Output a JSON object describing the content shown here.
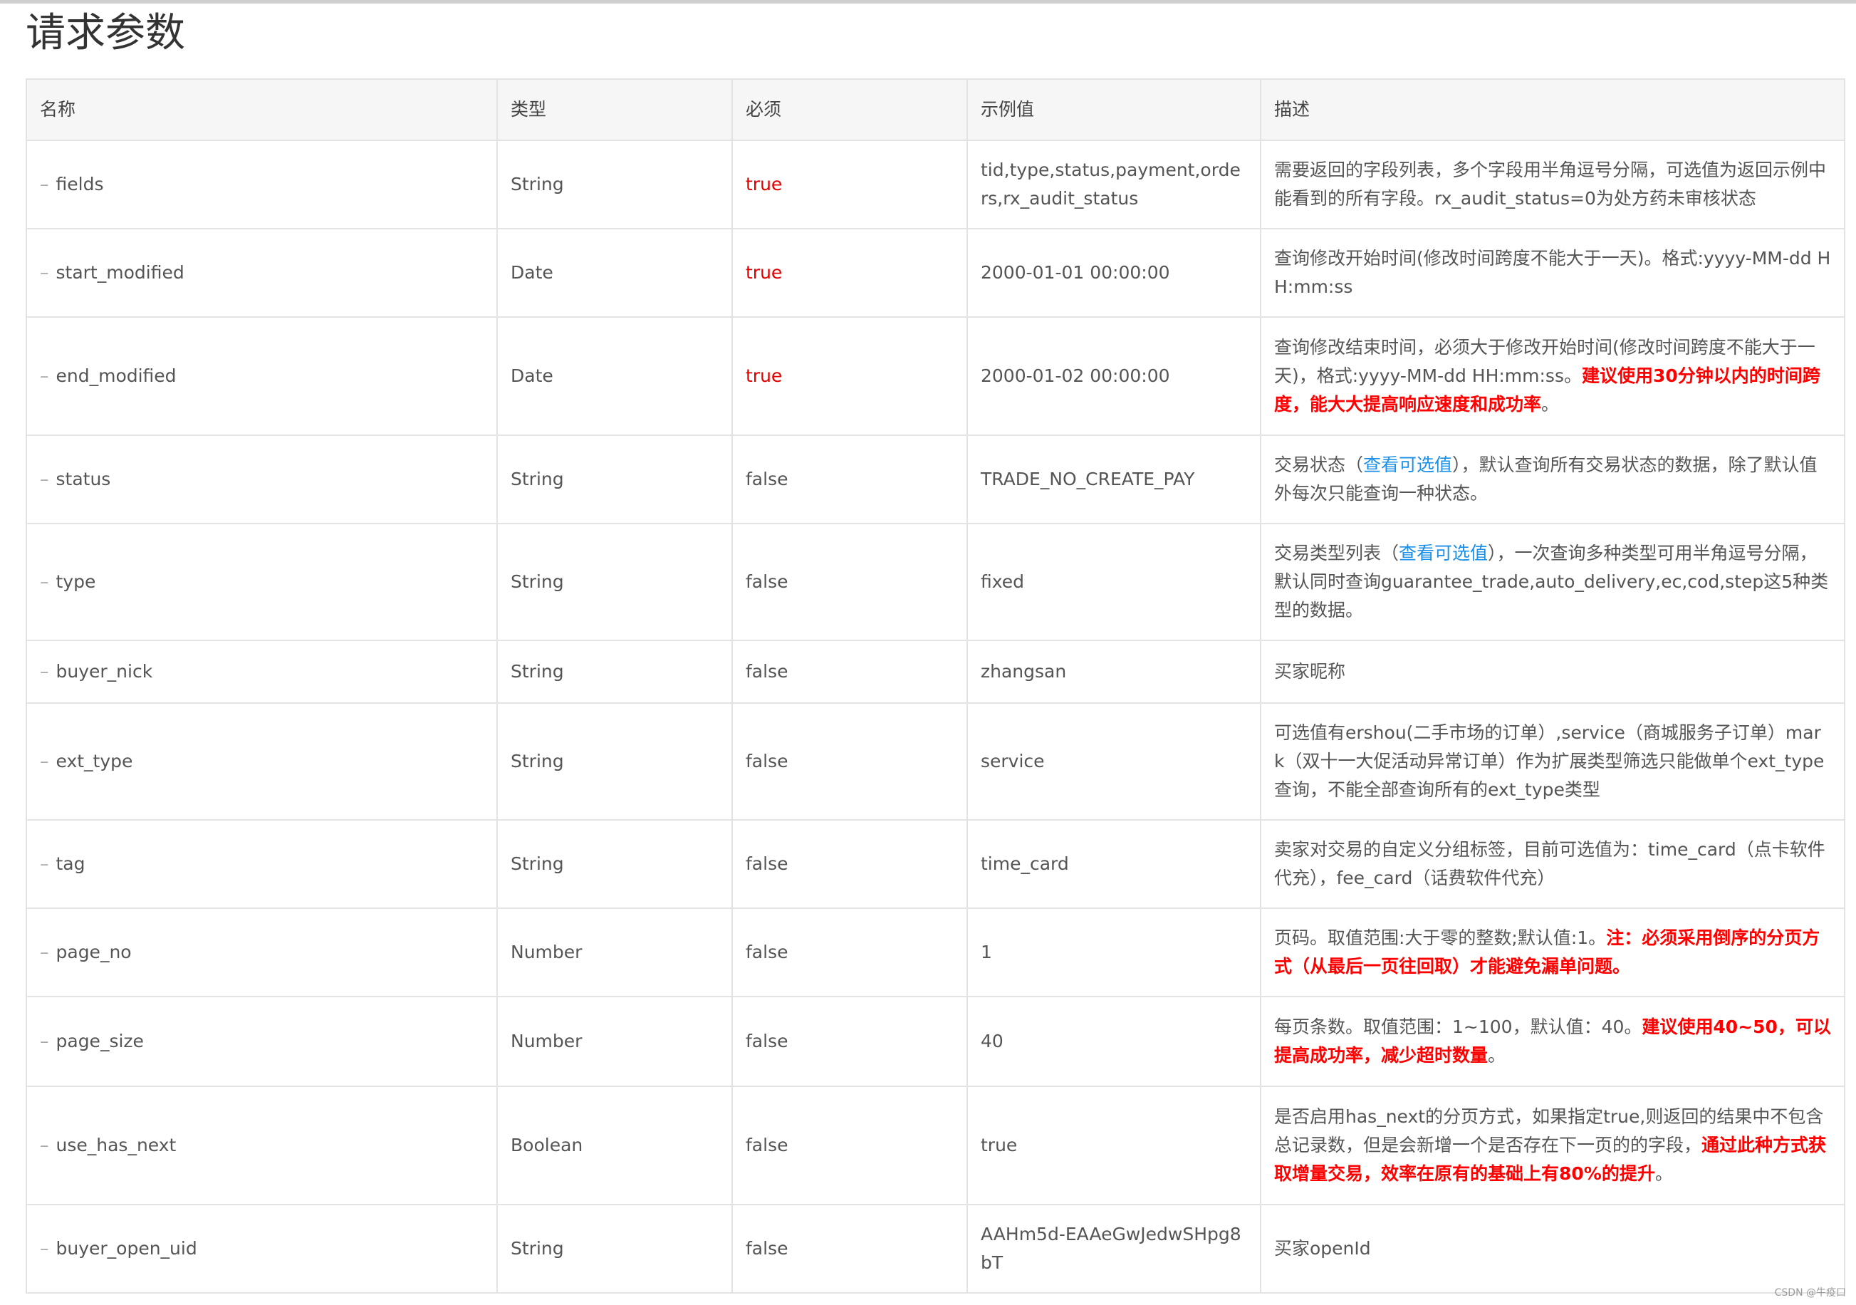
{
  "page_title": "请求参数",
  "table": {
    "headers": [
      "名称",
      "类型",
      "必须",
      "示例值",
      "描述"
    ],
    "rows": [
      {
        "name": "fields",
        "type": "String",
        "required": "true",
        "example": "tid,type,status,payment,orders,rx_audit_status",
        "desc": [
          {
            "t": "需要返回的字段列表，多个字段用半角逗号分隔，可选值为返回示例中能看到的所有字段。rx_audit_status=0为处方药未审核状态",
            "s": ""
          }
        ]
      },
      {
        "name": "start_modified",
        "type": "Date",
        "required": "true",
        "example": "2000-01-01 00:00:00",
        "desc": [
          {
            "t": "查询修改开始时间(修改时间跨度不能大于一天)。格式:yyyy-MM-dd HH:mm:ss",
            "s": ""
          }
        ]
      },
      {
        "name": "end_modified",
        "type": "Date",
        "required": "true",
        "example": "2000-01-02 00:00:00",
        "desc": [
          {
            "t": "查询修改结束时间，必须大于修改开始时间(修改时间跨度不能大于一天)，格式:yyyy-MM-dd HH:mm:ss。",
            "s": ""
          },
          {
            "t": "建议使用30分钟以内的时间跨度，能大大提高响应速度和成功率",
            "s": "strong"
          },
          {
            "t": "。",
            "s": ""
          }
        ]
      },
      {
        "name": "status",
        "type": "String",
        "required": "false",
        "example": "TRADE_NO_CREATE_PAY",
        "desc": [
          {
            "t": "交易状态（",
            "s": ""
          },
          {
            "t": "查看可选值",
            "s": "link"
          },
          {
            "t": "），默认查询所有交易状态的数据，除了默认值外每次只能查询一种状态。",
            "s": ""
          }
        ]
      },
      {
        "name": "type",
        "type": "String",
        "required": "false",
        "example": "fixed",
        "desc": [
          {
            "t": "交易类型列表（",
            "s": ""
          },
          {
            "t": "查看可选值",
            "s": "link"
          },
          {
            "t": "），一次查询多种类型可用半角逗号分隔，默认同时查询guarantee_trade,auto_delivery,ec,cod,step这5种类型的数据。",
            "s": ""
          }
        ]
      },
      {
        "name": "buyer_nick",
        "type": "String",
        "required": "false",
        "example": "zhangsan",
        "desc": [
          {
            "t": "买家昵称",
            "s": ""
          }
        ]
      },
      {
        "name": "ext_type",
        "type": "String",
        "required": "false",
        "example": "service",
        "desc": [
          {
            "t": "可选值有ershou(二手市场的订单）,service（商城服务子订单）mark（双十一大促活动异常订单）作为扩展类型筛选只能做单个ext_type查询，不能全部查询所有的ext_type类型",
            "s": ""
          }
        ]
      },
      {
        "name": "tag",
        "type": "String",
        "required": "false",
        "example": "time_card",
        "desc": [
          {
            "t": "卖家对交易的自定义分组标签，目前可选值为：time_card（点卡软件代充），fee_card（话费软件代充）",
            "s": ""
          }
        ]
      },
      {
        "name": "page_no",
        "type": "Number",
        "required": "false",
        "example": "1",
        "desc": [
          {
            "t": "页码。取值范围:大于零的整数;默认值:1。",
            "s": ""
          },
          {
            "t": "注：必须采用倒序的分页方式（从最后一页往回取）才能避免漏单问题。",
            "s": "strong"
          }
        ]
      },
      {
        "name": "page_size",
        "type": "Number",
        "required": "false",
        "example": "40",
        "desc": [
          {
            "t": "每页条数。取值范围：1~100，默认值：40。",
            "s": ""
          },
          {
            "t": "建议使用40~50，可以提高成功率，减少超时数量",
            "s": "strong"
          },
          {
            "t": "。",
            "s": ""
          }
        ]
      },
      {
        "name": "use_has_next",
        "type": "Boolean",
        "required": "false",
        "example": "true",
        "desc": [
          {
            "t": "是否启用has_next的分页方式，如果指定true,则返回的结果中不包含总记录数，但是会新增一个是否存在下一页的的字段，",
            "s": ""
          },
          {
            "t": "通过此种方式获取增量交易，效率在原有的基础上有80%的提升",
            "s": "strong"
          },
          {
            "t": "。",
            "s": ""
          }
        ]
      },
      {
        "name": "buyer_open_uid",
        "type": "String",
        "required": "false",
        "example": "AAHm5d-EAAeGwJedwSHpg8bT",
        "desc": [
          {
            "t": "买家openId",
            "s": ""
          }
        ]
      }
    ]
  },
  "watermark": "CSDN @牛疫口"
}
